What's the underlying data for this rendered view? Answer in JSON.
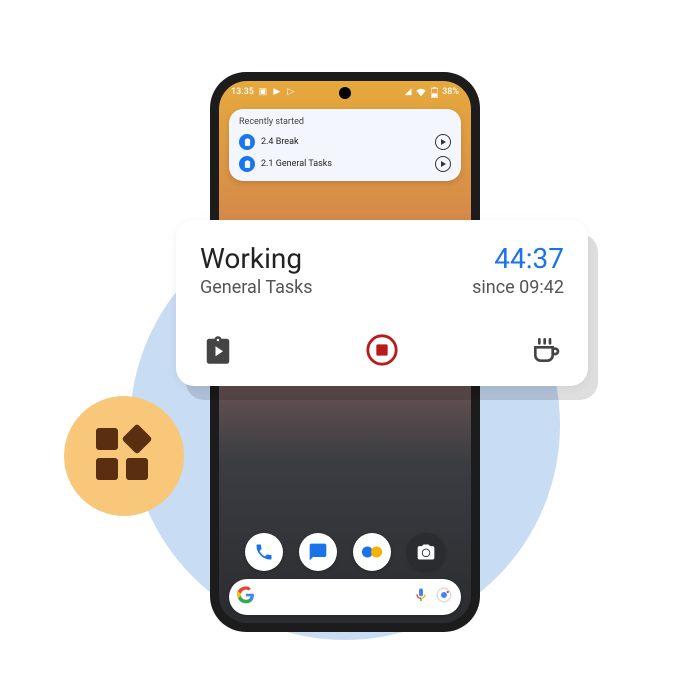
{
  "status_bar": {
    "time": "13:35",
    "battery": "38%"
  },
  "recent_widget": {
    "title": "Recently started",
    "items": [
      {
        "label": "2.4 Break"
      },
      {
        "label": "2.1 General Tasks"
      }
    ]
  },
  "card": {
    "title": "Working",
    "subtitle": "General Tasks",
    "elapsed": "44:37",
    "since": "since 09:42",
    "accent_color": "#1a73e8",
    "stop_color": "#b71c1c"
  },
  "icons": {
    "clipboard": "clipboard-play-icon",
    "stop": "stop-record-icon",
    "coffee": "coffee-cup-icon"
  }
}
